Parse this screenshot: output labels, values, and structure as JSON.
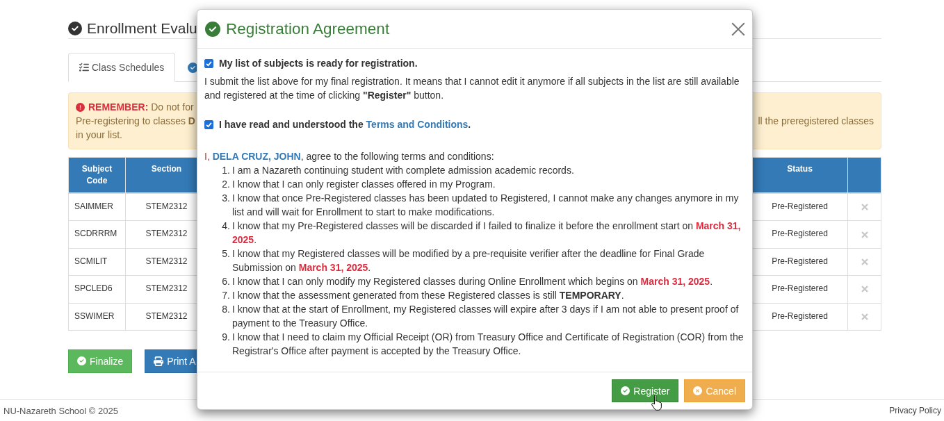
{
  "page": {
    "title": "Enrollment Evalu",
    "tabs": [
      {
        "label": "Class Schedules",
        "selected": true
      },
      {
        "selected": false
      }
    ],
    "alert": {
      "label": "REMEMBER:",
      "line_1": "Do not for",
      "line_2_start": "Pre-registering to classes **D**",
      "line_2_end": "ll the preregistered classes",
      "line_3": "in your list."
    },
    "table": {
      "columns": [
        "Subject Code",
        "Section",
        "Status"
      ],
      "rows": [
        {
          "subject_code": "SAIMMER",
          "section": "STEM2312",
          "status": "Pre-Registered"
        },
        {
          "subject_code": "SCDRRRM",
          "section": "STEM2312",
          "status": "Pre-Registered"
        },
        {
          "subject_code": "SCMILIT",
          "section": "STEM2312",
          "status": "Pre-Registered"
        },
        {
          "subject_code": "SPCLED6",
          "section": "STEM2312",
          "status": "Pre-Registered"
        },
        {
          "subject_code": "SSWIMER",
          "section": "STEM2312",
          "status": "Pre-Registered"
        }
      ]
    },
    "actions": [
      {
        "label": "Finalize",
        "kind": "success"
      },
      {
        "label": "Print A",
        "kind": "primary"
      }
    ]
  },
  "modal": {
    "title": "Registration Agreement",
    "confirmations": [
      {
        "checked": true,
        "label": "My list of subjects is ready for registration.",
        "description": "I submit the list above for my final registration. It means that I cannot edit it anymore if all subjects in the list are still available and registered at the time of clicking **\"Register\"** button."
      },
      {
        "checked": true,
        "label": "I have read and understood the",
        "link": "Terms and Conditions",
        "label_end": "."
      }
    ],
    "agreement": {
      "prefix": "I,",
      "name": "DELA CRUZ, JOHN",
      "suffix": ", agree to the following terms and conditions:"
    },
    "terms": [
      {
        "number": "1.",
        "parts": [
          {
            "kind": "plain",
            "text": "I am a Nazareth continuing student with complete admission academic records."
          }
        ]
      },
      {
        "number": "2.",
        "parts": [
          {
            "kind": "plain",
            "text": "I know that I can only register classes offered in my Program."
          }
        ]
      },
      {
        "number": "3.",
        "parts": [
          {
            "kind": "plain",
            "text": "I know that once Pre-Registered classes has been updated to Registered, I cannot make any changes anymore in my list and will wait for Enrollment to start to make modifications."
          }
        ]
      },
      {
        "number": "4.",
        "parts": [
          {
            "kind": "plain",
            "text": "I know that my Pre-Registered classes will be discarded if I failed to finalize it before the enrollment start on "
          },
          {
            "kind": "date",
            "text": "March 31, 2025"
          },
          {
            "kind": "plain",
            "text": "."
          }
        ]
      },
      {
        "number": "5.",
        "parts": [
          {
            "kind": "plain",
            "text": "I know that my Registered classes will be modified by a pre-requisite verifier after the deadline for Final Grade Submission on "
          },
          {
            "kind": "date",
            "text": "March 31, 2025"
          },
          {
            "kind": "plain",
            "text": "."
          }
        ]
      },
      {
        "number": "6.",
        "parts": [
          {
            "kind": "plain",
            "text": "I know that I can only modify my Registered classes during Online Enrollment which begins on "
          },
          {
            "kind": "date",
            "text": "March 31, 2025"
          },
          {
            "kind": "plain",
            "text": "."
          }
        ]
      },
      {
        "number": "7.",
        "parts": [
          {
            "kind": "plain",
            "text": "I know that the assessment generated from these Registered classes is still "
          },
          {
            "kind": "strong",
            "text": "TEMPORARY"
          },
          {
            "kind": "plain",
            "text": "."
          }
        ]
      },
      {
        "number": "8.",
        "parts": [
          {
            "kind": "plain",
            "text": "I know that at the start of Enrollment, my Registered classes will expire after 3 days if I am not able to present proof of payment to the Treasury Office."
          }
        ]
      },
      {
        "number": "9.",
        "parts": [
          {
            "kind": "plain",
            "text": "I know that I need to claim my Official Receipt (OR) from Treasury Office and Certificate of Registration (COR) from the Registrar's Office after payment is accepted by the Treasury Office."
          }
        ]
      }
    ],
    "buttons": [
      {
        "label": "Register",
        "kind": "success",
        "hovered": true
      },
      {
        "label": "Cancel",
        "kind": "warning",
        "hovered": false
      }
    ]
  },
  "footer": {
    "copyright": "NU-Nazareth School © 2025",
    "link": "Privacy Policy"
  }
}
